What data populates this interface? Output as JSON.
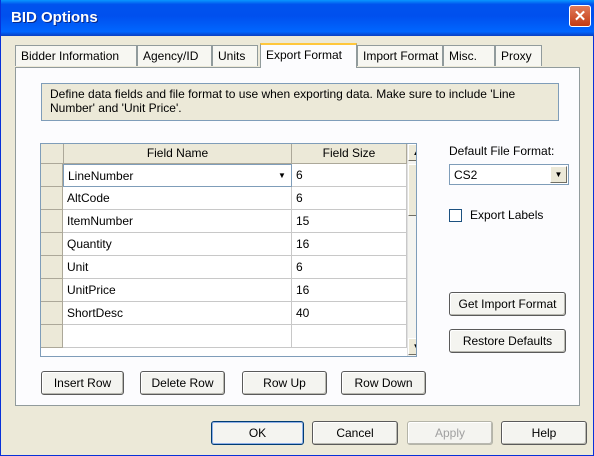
{
  "window": {
    "title": "BID Options",
    "close_glyph": "✕"
  },
  "tabs": [
    {
      "label": "Bidder Information"
    },
    {
      "label": "Agency/ID"
    },
    {
      "label": "Units"
    },
    {
      "label": "Export Format",
      "active": true
    },
    {
      "label": "Import Format"
    },
    {
      "label": "Misc."
    },
    {
      "label": "Proxy"
    }
  ],
  "description": "Define data fields and file format to use when exporting data.  Make sure to include 'Line Number' and 'Unit Price'.",
  "grid": {
    "columns": [
      "Field Name",
      "Field Size"
    ],
    "rows": [
      {
        "name": "LineNumber",
        "size": "6"
      },
      {
        "name": "AltCode",
        "size": "6"
      },
      {
        "name": "ItemNumber",
        "size": "15"
      },
      {
        "name": "Quantity",
        "size": "16"
      },
      {
        "name": "Unit",
        "size": "6"
      },
      {
        "name": "UnitPrice",
        "size": "16"
      },
      {
        "name": "ShortDesc",
        "size": "40"
      },
      {
        "name": "",
        "size": ""
      }
    ]
  },
  "side": {
    "default_format_label": "Default File Format:",
    "default_format_value": "CS2",
    "export_labels_label": "Export Labels",
    "export_labels_checked": false,
    "get_import_format": "Get Import Format",
    "restore_defaults": "Restore Defaults"
  },
  "row_buttons": {
    "insert": "Insert Row",
    "delete": "Delete Row",
    "up": "Row Up",
    "down": "Row Down"
  },
  "dialog_buttons": {
    "ok": "OK",
    "cancel": "Cancel",
    "apply": "Apply",
    "help": "Help"
  },
  "icons": {
    "dropdown": "▼",
    "scroll_up": "▲",
    "scroll_down": "▼"
  }
}
